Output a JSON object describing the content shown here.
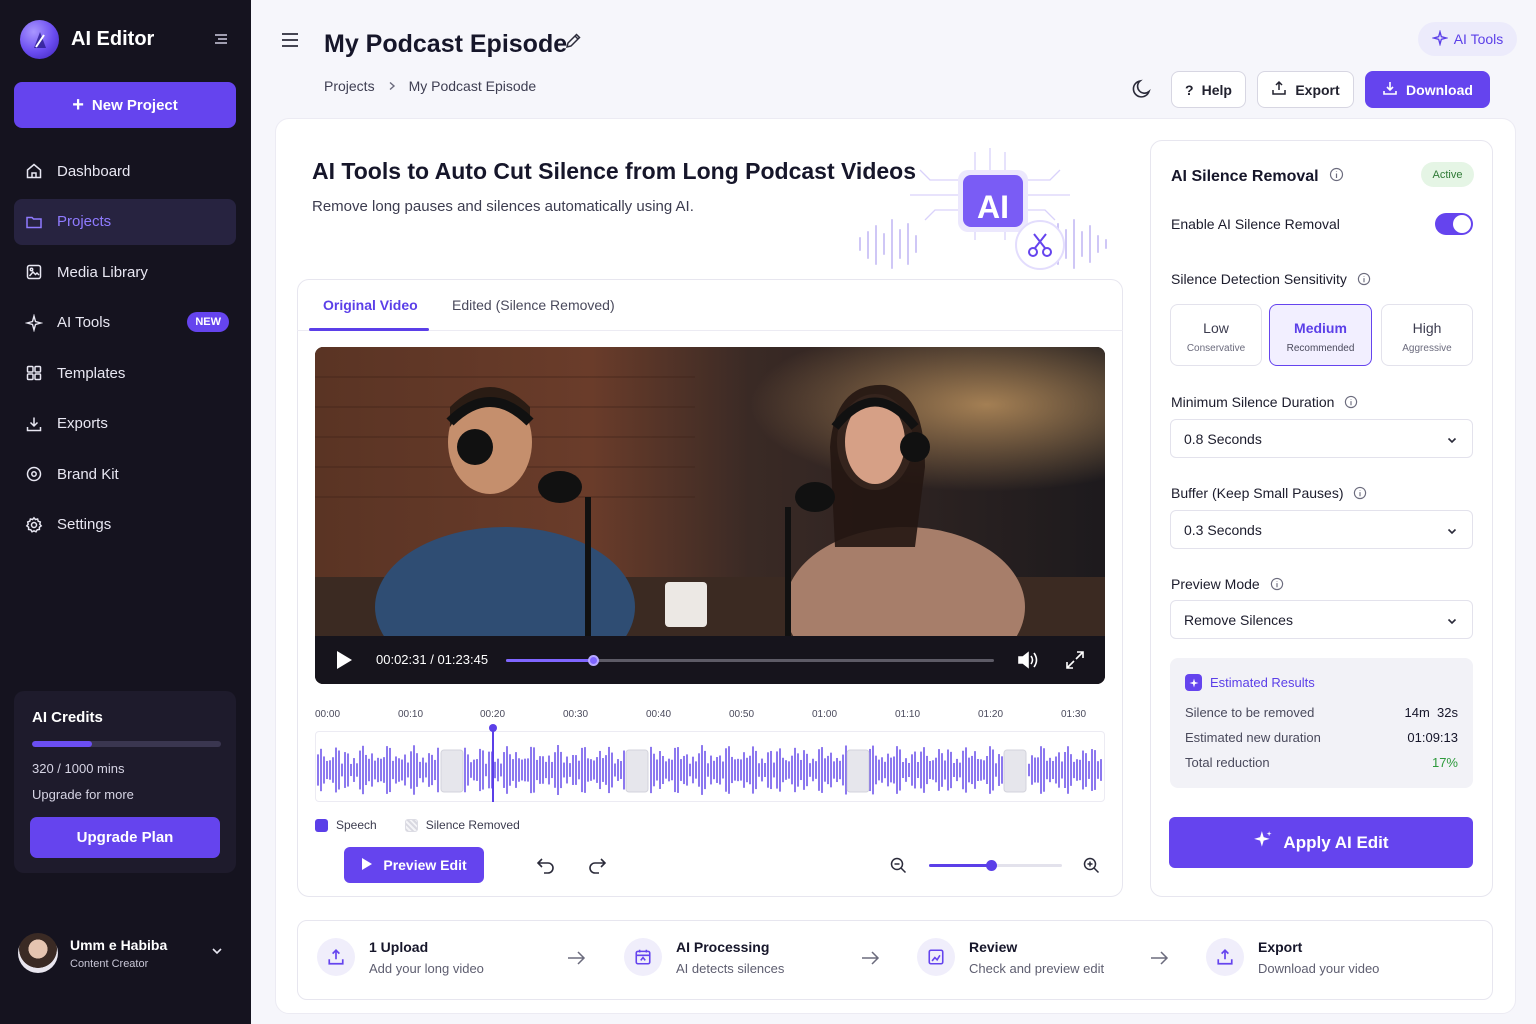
{
  "app": {
    "name": "AI Editor"
  },
  "sidebar": {
    "new_project": "New Project",
    "items": [
      {
        "label": "Dashboard",
        "icon": "home-icon"
      },
      {
        "label": "Projects",
        "icon": "folder-icon",
        "active": true
      },
      {
        "label": "Media Library",
        "icon": "image-icon"
      },
      {
        "label": "AI Tools",
        "icon": "sparkles-icon",
        "badge": "NEW"
      },
      {
        "label": "Templates",
        "icon": "grid-icon"
      },
      {
        "label": "Exports",
        "icon": "download-icon"
      },
      {
        "label": "Brand Kit",
        "icon": "palette-icon"
      },
      {
        "label": "Settings",
        "icon": "gear-icon"
      }
    ],
    "credits": {
      "title": "AI Credits",
      "used": 320,
      "total": 1000,
      "count_text": "320 / 1000 mins",
      "upgrade_text": "Upgrade for more",
      "upgrade_button": "Upgrade Plan"
    },
    "user": {
      "name": "Umm e Habiba",
      "role": "Content Creator"
    }
  },
  "header": {
    "title": "My Podcast Episode",
    "breadcrumb": [
      "Projects",
      "My Podcast Episode"
    ],
    "ai_tools": "AI Tools",
    "help": "Help",
    "export": "Export",
    "download": "Download"
  },
  "hero": {
    "title": "AI Tools to Auto Cut Silence from Long Podcast Videos",
    "subtitle": "Remove long pauses and silences automatically using AI.",
    "badge": "AI"
  },
  "video": {
    "tabs": [
      "Original Video",
      "Edited (Silence Removed)"
    ],
    "active_tab": 0,
    "time_current": "00:02:31",
    "time_total": "01:23:45",
    "timecode": "00:02:31 / 01:23:45",
    "progress": 0.18,
    "ruler": [
      "00:00",
      "00:10",
      "00:20",
      "00:30",
      "00:40",
      "00:50",
      "01:00",
      "01:10",
      "01:20",
      "01:30"
    ],
    "legend": {
      "speech": "Speech",
      "silence": "Silence Removed"
    },
    "preview_button": "Preview Edit",
    "zoom_level": 0.47,
    "colors": {
      "accent": "#6544ee",
      "speech": "#5b3fe8"
    }
  },
  "settings": {
    "title": "AI Silence Removal",
    "status": "Active",
    "enable_label": "Enable AI Silence Removal",
    "enabled": true,
    "sensitivity_label": "Silence Detection Sensitivity",
    "sensitivity": [
      {
        "label": "Low",
        "sub": "Conservative"
      },
      {
        "label": "Medium",
        "sub": "Recommended",
        "selected": true
      },
      {
        "label": "High",
        "sub": "Aggressive"
      }
    ],
    "min_silence_label": "Minimum Silence Duration",
    "min_silence_value": "0.8 Seconds",
    "buffer_label": "Buffer",
    "buffer_hint": "(Keep Small Pauses)",
    "buffer_value": "0.3 Seconds",
    "preview_mode_label": "Preview Mode",
    "preview_mode_value": "Remove Silences",
    "estimated": {
      "title": "Estimated Results",
      "rows": [
        {
          "label": "Silence to be removed",
          "value": "14m  32s"
        },
        {
          "label": "Estimated new duration",
          "value": "01:09:13"
        },
        {
          "label": "Total reduction",
          "value": "17%"
        }
      ]
    },
    "apply_button": "Apply AI Edit"
  },
  "steps": [
    {
      "title": "1 Upload",
      "sub": "Add your long video",
      "icon": "upload-icon"
    },
    {
      "title": "AI Processing",
      "sub": "AI detects silences",
      "icon": "calendar-ai-icon"
    },
    {
      "title": "Review",
      "sub": "Check and preview edit",
      "icon": "review-icon"
    },
    {
      "title": "Export",
      "sub": "Download your video",
      "icon": "export-icon"
    }
  ]
}
